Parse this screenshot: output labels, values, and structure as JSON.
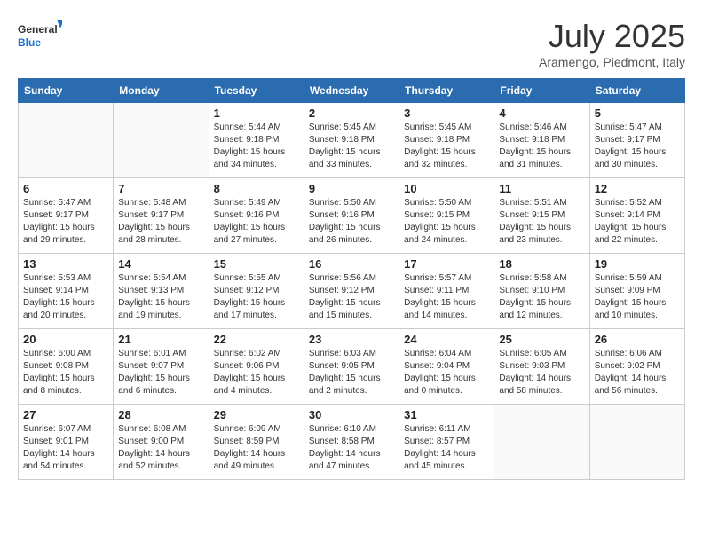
{
  "header": {
    "logo_general": "General",
    "logo_blue": "Blue",
    "month_title": "July 2025",
    "location": "Aramengo, Piedmont, Italy"
  },
  "days_of_week": [
    "Sunday",
    "Monday",
    "Tuesday",
    "Wednesday",
    "Thursday",
    "Friday",
    "Saturday"
  ],
  "weeks": [
    [
      {
        "day": "",
        "info": ""
      },
      {
        "day": "",
        "info": ""
      },
      {
        "day": "1",
        "info": "Sunrise: 5:44 AM\nSunset: 9:18 PM\nDaylight: 15 hours\nand 34 minutes."
      },
      {
        "day": "2",
        "info": "Sunrise: 5:45 AM\nSunset: 9:18 PM\nDaylight: 15 hours\nand 33 minutes."
      },
      {
        "day": "3",
        "info": "Sunrise: 5:45 AM\nSunset: 9:18 PM\nDaylight: 15 hours\nand 32 minutes."
      },
      {
        "day": "4",
        "info": "Sunrise: 5:46 AM\nSunset: 9:18 PM\nDaylight: 15 hours\nand 31 minutes."
      },
      {
        "day": "5",
        "info": "Sunrise: 5:47 AM\nSunset: 9:17 PM\nDaylight: 15 hours\nand 30 minutes."
      }
    ],
    [
      {
        "day": "6",
        "info": "Sunrise: 5:47 AM\nSunset: 9:17 PM\nDaylight: 15 hours\nand 29 minutes."
      },
      {
        "day": "7",
        "info": "Sunrise: 5:48 AM\nSunset: 9:17 PM\nDaylight: 15 hours\nand 28 minutes."
      },
      {
        "day": "8",
        "info": "Sunrise: 5:49 AM\nSunset: 9:16 PM\nDaylight: 15 hours\nand 27 minutes."
      },
      {
        "day": "9",
        "info": "Sunrise: 5:50 AM\nSunset: 9:16 PM\nDaylight: 15 hours\nand 26 minutes."
      },
      {
        "day": "10",
        "info": "Sunrise: 5:50 AM\nSunset: 9:15 PM\nDaylight: 15 hours\nand 24 minutes."
      },
      {
        "day": "11",
        "info": "Sunrise: 5:51 AM\nSunset: 9:15 PM\nDaylight: 15 hours\nand 23 minutes."
      },
      {
        "day": "12",
        "info": "Sunrise: 5:52 AM\nSunset: 9:14 PM\nDaylight: 15 hours\nand 22 minutes."
      }
    ],
    [
      {
        "day": "13",
        "info": "Sunrise: 5:53 AM\nSunset: 9:14 PM\nDaylight: 15 hours\nand 20 minutes."
      },
      {
        "day": "14",
        "info": "Sunrise: 5:54 AM\nSunset: 9:13 PM\nDaylight: 15 hours\nand 19 minutes."
      },
      {
        "day": "15",
        "info": "Sunrise: 5:55 AM\nSunset: 9:12 PM\nDaylight: 15 hours\nand 17 minutes."
      },
      {
        "day": "16",
        "info": "Sunrise: 5:56 AM\nSunset: 9:12 PM\nDaylight: 15 hours\nand 15 minutes."
      },
      {
        "day": "17",
        "info": "Sunrise: 5:57 AM\nSunset: 9:11 PM\nDaylight: 15 hours\nand 14 minutes."
      },
      {
        "day": "18",
        "info": "Sunrise: 5:58 AM\nSunset: 9:10 PM\nDaylight: 15 hours\nand 12 minutes."
      },
      {
        "day": "19",
        "info": "Sunrise: 5:59 AM\nSunset: 9:09 PM\nDaylight: 15 hours\nand 10 minutes."
      }
    ],
    [
      {
        "day": "20",
        "info": "Sunrise: 6:00 AM\nSunset: 9:08 PM\nDaylight: 15 hours\nand 8 minutes."
      },
      {
        "day": "21",
        "info": "Sunrise: 6:01 AM\nSunset: 9:07 PM\nDaylight: 15 hours\nand 6 minutes."
      },
      {
        "day": "22",
        "info": "Sunrise: 6:02 AM\nSunset: 9:06 PM\nDaylight: 15 hours\nand 4 minutes."
      },
      {
        "day": "23",
        "info": "Sunrise: 6:03 AM\nSunset: 9:05 PM\nDaylight: 15 hours\nand 2 minutes."
      },
      {
        "day": "24",
        "info": "Sunrise: 6:04 AM\nSunset: 9:04 PM\nDaylight: 15 hours\nand 0 minutes."
      },
      {
        "day": "25",
        "info": "Sunrise: 6:05 AM\nSunset: 9:03 PM\nDaylight: 14 hours\nand 58 minutes."
      },
      {
        "day": "26",
        "info": "Sunrise: 6:06 AM\nSunset: 9:02 PM\nDaylight: 14 hours\nand 56 minutes."
      }
    ],
    [
      {
        "day": "27",
        "info": "Sunrise: 6:07 AM\nSunset: 9:01 PM\nDaylight: 14 hours\nand 54 minutes."
      },
      {
        "day": "28",
        "info": "Sunrise: 6:08 AM\nSunset: 9:00 PM\nDaylight: 14 hours\nand 52 minutes."
      },
      {
        "day": "29",
        "info": "Sunrise: 6:09 AM\nSunset: 8:59 PM\nDaylight: 14 hours\nand 49 minutes."
      },
      {
        "day": "30",
        "info": "Sunrise: 6:10 AM\nSunset: 8:58 PM\nDaylight: 14 hours\nand 47 minutes."
      },
      {
        "day": "31",
        "info": "Sunrise: 6:11 AM\nSunset: 8:57 PM\nDaylight: 14 hours\nand 45 minutes."
      },
      {
        "day": "",
        "info": ""
      },
      {
        "day": "",
        "info": ""
      }
    ]
  ]
}
